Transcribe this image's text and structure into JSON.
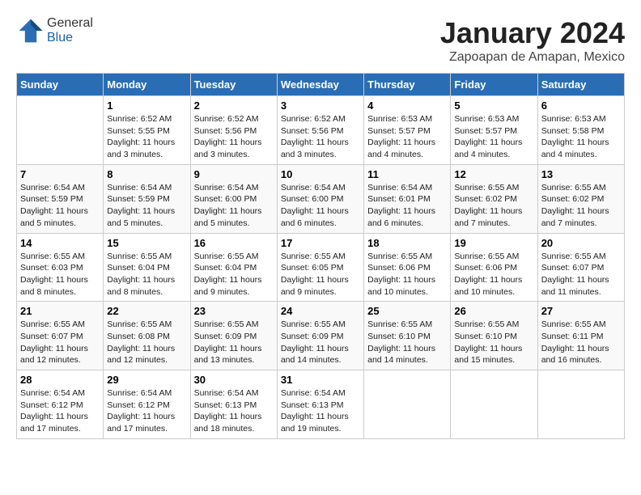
{
  "header": {
    "logo_general": "General",
    "logo_blue": "Blue",
    "month": "January 2024",
    "location": "Zapoapan de Amapan, Mexico"
  },
  "days_of_week": [
    "Sunday",
    "Monday",
    "Tuesday",
    "Wednesday",
    "Thursday",
    "Friday",
    "Saturday"
  ],
  "weeks": [
    [
      null,
      {
        "num": "1",
        "sunrise": "Sunrise: 6:52 AM",
        "sunset": "Sunset: 5:55 PM",
        "daylight": "Daylight: 11 hours and 3 minutes."
      },
      {
        "num": "2",
        "sunrise": "Sunrise: 6:52 AM",
        "sunset": "Sunset: 5:56 PM",
        "daylight": "Daylight: 11 hours and 3 minutes."
      },
      {
        "num": "3",
        "sunrise": "Sunrise: 6:52 AM",
        "sunset": "Sunset: 5:56 PM",
        "daylight": "Daylight: 11 hours and 3 minutes."
      },
      {
        "num": "4",
        "sunrise": "Sunrise: 6:53 AM",
        "sunset": "Sunset: 5:57 PM",
        "daylight": "Daylight: 11 hours and 4 minutes."
      },
      {
        "num": "5",
        "sunrise": "Sunrise: 6:53 AM",
        "sunset": "Sunset: 5:57 PM",
        "daylight": "Daylight: 11 hours and 4 minutes."
      },
      {
        "num": "6",
        "sunrise": "Sunrise: 6:53 AM",
        "sunset": "Sunset: 5:58 PM",
        "daylight": "Daylight: 11 hours and 4 minutes."
      }
    ],
    [
      {
        "num": "7",
        "sunrise": "Sunrise: 6:54 AM",
        "sunset": "Sunset: 5:59 PM",
        "daylight": "Daylight: 11 hours and 5 minutes."
      },
      {
        "num": "8",
        "sunrise": "Sunrise: 6:54 AM",
        "sunset": "Sunset: 5:59 PM",
        "daylight": "Daylight: 11 hours and 5 minutes."
      },
      {
        "num": "9",
        "sunrise": "Sunrise: 6:54 AM",
        "sunset": "Sunset: 6:00 PM",
        "daylight": "Daylight: 11 hours and 5 minutes."
      },
      {
        "num": "10",
        "sunrise": "Sunrise: 6:54 AM",
        "sunset": "Sunset: 6:00 PM",
        "daylight": "Daylight: 11 hours and 6 minutes."
      },
      {
        "num": "11",
        "sunrise": "Sunrise: 6:54 AM",
        "sunset": "Sunset: 6:01 PM",
        "daylight": "Daylight: 11 hours and 6 minutes."
      },
      {
        "num": "12",
        "sunrise": "Sunrise: 6:55 AM",
        "sunset": "Sunset: 6:02 PM",
        "daylight": "Daylight: 11 hours and 7 minutes."
      },
      {
        "num": "13",
        "sunrise": "Sunrise: 6:55 AM",
        "sunset": "Sunset: 6:02 PM",
        "daylight": "Daylight: 11 hours and 7 minutes."
      }
    ],
    [
      {
        "num": "14",
        "sunrise": "Sunrise: 6:55 AM",
        "sunset": "Sunset: 6:03 PM",
        "daylight": "Daylight: 11 hours and 8 minutes."
      },
      {
        "num": "15",
        "sunrise": "Sunrise: 6:55 AM",
        "sunset": "Sunset: 6:04 PM",
        "daylight": "Daylight: 11 hours and 8 minutes."
      },
      {
        "num": "16",
        "sunrise": "Sunrise: 6:55 AM",
        "sunset": "Sunset: 6:04 PM",
        "daylight": "Daylight: 11 hours and 9 minutes."
      },
      {
        "num": "17",
        "sunrise": "Sunrise: 6:55 AM",
        "sunset": "Sunset: 6:05 PM",
        "daylight": "Daylight: 11 hours and 9 minutes."
      },
      {
        "num": "18",
        "sunrise": "Sunrise: 6:55 AM",
        "sunset": "Sunset: 6:06 PM",
        "daylight": "Daylight: 11 hours and 10 minutes."
      },
      {
        "num": "19",
        "sunrise": "Sunrise: 6:55 AM",
        "sunset": "Sunset: 6:06 PM",
        "daylight": "Daylight: 11 hours and 10 minutes."
      },
      {
        "num": "20",
        "sunrise": "Sunrise: 6:55 AM",
        "sunset": "Sunset: 6:07 PM",
        "daylight": "Daylight: 11 hours and 11 minutes."
      }
    ],
    [
      {
        "num": "21",
        "sunrise": "Sunrise: 6:55 AM",
        "sunset": "Sunset: 6:07 PM",
        "daylight": "Daylight: 11 hours and 12 minutes."
      },
      {
        "num": "22",
        "sunrise": "Sunrise: 6:55 AM",
        "sunset": "Sunset: 6:08 PM",
        "daylight": "Daylight: 11 hours and 12 minutes."
      },
      {
        "num": "23",
        "sunrise": "Sunrise: 6:55 AM",
        "sunset": "Sunset: 6:09 PM",
        "daylight": "Daylight: 11 hours and 13 minutes."
      },
      {
        "num": "24",
        "sunrise": "Sunrise: 6:55 AM",
        "sunset": "Sunset: 6:09 PM",
        "daylight": "Daylight: 11 hours and 14 minutes."
      },
      {
        "num": "25",
        "sunrise": "Sunrise: 6:55 AM",
        "sunset": "Sunset: 6:10 PM",
        "daylight": "Daylight: 11 hours and 14 minutes."
      },
      {
        "num": "26",
        "sunrise": "Sunrise: 6:55 AM",
        "sunset": "Sunset: 6:10 PM",
        "daylight": "Daylight: 11 hours and 15 minutes."
      },
      {
        "num": "27",
        "sunrise": "Sunrise: 6:55 AM",
        "sunset": "Sunset: 6:11 PM",
        "daylight": "Daylight: 11 hours and 16 minutes."
      }
    ],
    [
      {
        "num": "28",
        "sunrise": "Sunrise: 6:54 AM",
        "sunset": "Sunset: 6:12 PM",
        "daylight": "Daylight: 11 hours and 17 minutes."
      },
      {
        "num": "29",
        "sunrise": "Sunrise: 6:54 AM",
        "sunset": "Sunset: 6:12 PM",
        "daylight": "Daylight: 11 hours and 17 minutes."
      },
      {
        "num": "30",
        "sunrise": "Sunrise: 6:54 AM",
        "sunset": "Sunset: 6:13 PM",
        "daylight": "Daylight: 11 hours and 18 minutes."
      },
      {
        "num": "31",
        "sunrise": "Sunrise: 6:54 AM",
        "sunset": "Sunset: 6:13 PM",
        "daylight": "Daylight: 11 hours and 19 minutes."
      },
      null,
      null,
      null
    ]
  ]
}
